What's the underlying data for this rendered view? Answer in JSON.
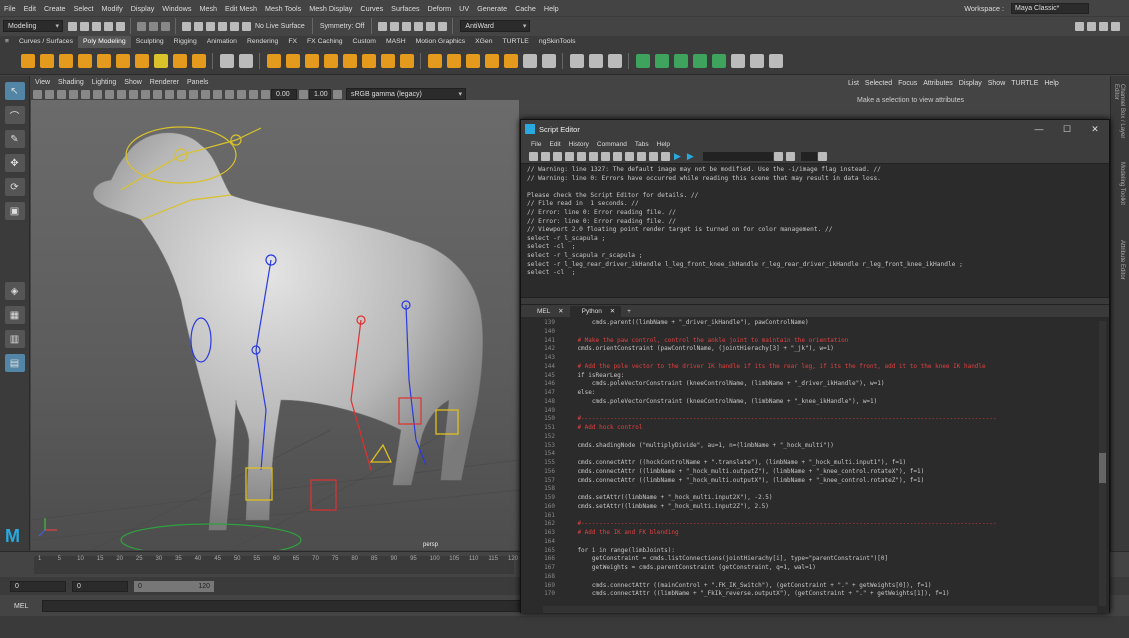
{
  "menubar": {
    "items": [
      "File",
      "Edit",
      "Create",
      "Select",
      "Modify",
      "Display",
      "Windows",
      "Mesh",
      "Edit Mesh",
      "Mesh Tools",
      "Mesh Display",
      "Curves",
      "Surfaces",
      "Deform",
      "UV",
      "Generate",
      "Cache",
      "Help"
    ],
    "workspace_label": "Workspace :",
    "workspace_value": "Maya Classic*"
  },
  "statusline": {
    "mode": "Modeling",
    "live_surface": "No Live Surface",
    "symmetry": "Symmetry: Off",
    "user": "AntiWard"
  },
  "shelf": {
    "tabs": [
      "Curves / Surfaces",
      "Poly Modeling",
      "Sculpting",
      "Rigging",
      "Animation",
      "Rendering",
      "FX",
      "FX Caching",
      "Custom",
      "MASH",
      "Motion Graphics",
      "XGen",
      "TURTLE",
      "ngSkinTools"
    ],
    "active": "Poly Modeling"
  },
  "viewport": {
    "menu": [
      "View",
      "Shading",
      "Lighting",
      "Show",
      "Renderer",
      "Panels"
    ],
    "exposure": "0.00",
    "gamma": "1.00",
    "colorspace": "sRGB gamma (legacy)",
    "camera": "persp"
  },
  "right_panel": {
    "menu": [
      "List",
      "Selected",
      "Focus",
      "Attributes",
      "Display",
      "Show",
      "TURTLE",
      "Help"
    ],
    "message": "Make a selection to view attributes",
    "strip_tabs": [
      "Channel Box / Layer Editor",
      "Modeling Toolkit",
      "Attribute Editor"
    ]
  },
  "script_editor": {
    "title": "Script Editor",
    "menu": [
      "File",
      "Edit",
      "History",
      "Command",
      "Tabs",
      "Help"
    ],
    "output": [
      "// Warning: line 1327: The default image may not be modified. Use the -i/image flag instead. //",
      "// Warning: line 0: Errors have occurred while reading this scene that may result in data loss.",
      "",
      "Please check the Script Editor for details. //",
      "// File read in  1 seconds. //",
      "// Error: line 0: Error reading file. //",
      "// Error: line 0: Error reading file. //",
      "// Viewport 2.0 floating point render target is turned on for color management. //",
      "select -r l_scapula ;",
      "select -cl  ;",
      "select -r l_scapula r_scapula ;",
      "select -r l_leg_rear_driver_ikHandle l_leg_front_knee_ikHandle r_leg_rear_driver_ikHandle r_leg_front_knee_ikHandle ;",
      "select -cl  ;"
    ],
    "tabs": [
      "MEL",
      "Python"
    ],
    "active_tab": "Python",
    "code": [
      {
        "n": "139",
        "t": "        cmds.parent((limbName + \"_driver_ikHandle\"), pawControlName)",
        "c": ""
      },
      {
        "n": "140",
        "t": "",
        "c": ""
      },
      {
        "n": "141",
        "t": "    # Make the paw control, control the ankle joint to maintain the orientation",
        "c": "c-cm"
      },
      {
        "n": "142",
        "t": "    cmds.orientConstraint (pawControlName, (jointHierachy[3] + \"_jk\"), w=1)",
        "c": ""
      },
      {
        "n": "143",
        "t": "",
        "c": ""
      },
      {
        "n": "144",
        "t": "    # Add the pole vector to the driver IK handle if its the rear leg, if its the front, add it to the knee IK handle",
        "c": "c-cm"
      },
      {
        "n": "145",
        "t": "    if isRearLeg:",
        "c": ""
      },
      {
        "n": "146",
        "t": "        cmds.poleVectorConstraint (kneeControlName, (limbName + \"_driver_ikHandle\"), w=1)",
        "c": ""
      },
      {
        "n": "147",
        "t": "    else:",
        "c": ""
      },
      {
        "n": "148",
        "t": "        cmds.poleVectorConstraint (kneeControlName, (limbName + \"_knee_ikHandle\"), w=1)",
        "c": ""
      },
      {
        "n": "149",
        "t": "",
        "c": ""
      },
      {
        "n": "150",
        "t": "    #-------------------------------------------------------------------------------------------------------------------",
        "c": "c-cm"
      },
      {
        "n": "151",
        "t": "    # Add hock control",
        "c": "c-cm"
      },
      {
        "n": "152",
        "t": "",
        "c": ""
      },
      {
        "n": "153",
        "t": "    cmds.shadingNode (\"multiplyDivide\", au=1, n=(limbName + \"_hock_multi\"))",
        "c": ""
      },
      {
        "n": "154",
        "t": "",
        "c": ""
      },
      {
        "n": "155",
        "t": "    cmds.connectAttr ((hockControlName + \".translate\"), (limbName + \"_hock_multi.input1\"), f=1)",
        "c": ""
      },
      {
        "n": "156",
        "t": "    cmds.connectAttr ((limbName + \"_hock_multi.outputZ\"), (limbName + \"_knee_control.rotateX\"), f=1)",
        "c": ""
      },
      {
        "n": "157",
        "t": "    cmds.connectAttr ((limbName + \"_hock_multi.outputX\"), (limbName + \"_knee_control.rotateZ\"), f=1)",
        "c": ""
      },
      {
        "n": "158",
        "t": "",
        "c": ""
      },
      {
        "n": "159",
        "t": "    cmds.setAttr((limbName + \"_hock_multi.input2X\"), -2.5)",
        "c": ""
      },
      {
        "n": "160",
        "t": "    cmds.setAttr((limbName + \"_hock_multi.input2Z\"), 2.5)",
        "c": ""
      },
      {
        "n": "161",
        "t": "",
        "c": ""
      },
      {
        "n": "162",
        "t": "    #-------------------------------------------------------------------------------------------------------------------",
        "c": "c-cm"
      },
      {
        "n": "163",
        "t": "    # Add the IK and FK blending",
        "c": "c-cm"
      },
      {
        "n": "164",
        "t": "",
        "c": ""
      },
      {
        "n": "165",
        "t": "    for i in range(limbJoints):",
        "c": ""
      },
      {
        "n": "166",
        "t": "        getConstraint = cmds.listConnections(jointHierachy[i], type=\"parentConstraint\")[0]",
        "c": ""
      },
      {
        "n": "167",
        "t": "        getWeights = cmds.parentConstraint (getConstraint, q=1, wal=1)",
        "c": ""
      },
      {
        "n": "168",
        "t": "",
        "c": ""
      },
      {
        "n": "169",
        "t": "        cmds.connectAttr ((mainControl + \".FK_IK_Switch\"), (getConstraint + \".\" + getWeights[0]), f=1)",
        "c": ""
      },
      {
        "n": "170",
        "t": "        cmds.connectAttr ((limbName + \"_FkIk_reverse.outputX\"), (getConstraint + \".\" + getWeights[1]), f=1)",
        "c": ""
      }
    ]
  },
  "timeslider": {
    "ticks": [
      "1",
      "5",
      "10",
      "15",
      "20",
      "25",
      "30",
      "35",
      "40",
      "45",
      "50",
      "55",
      "60",
      "65",
      "70",
      "75",
      "80",
      "85",
      "90",
      "95",
      "100",
      "105",
      "110",
      "115",
      "120"
    ]
  },
  "range": {
    "start": "0",
    "start2": "0",
    "inner_start": "0",
    "inner_end": "120"
  },
  "cmdline": {
    "label": "MEL"
  }
}
